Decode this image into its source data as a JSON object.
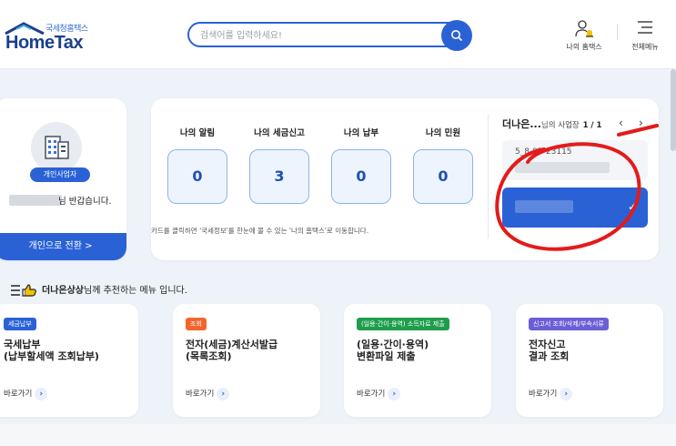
{
  "header": {
    "logo_sub": "국세청홈택스",
    "logo_main": "HomeTax",
    "search_placeholder": "검색어를 입력하세요!",
    "my_hometax_label": "나의 홈택스",
    "all_menu_label": "전체메뉴"
  },
  "profile": {
    "badge": "개인사업자",
    "greeting": "님 반갑습니다.",
    "switch_label": "개인으로 전환 >"
  },
  "status": {
    "items": [
      {
        "label": "나의 알림",
        "value": "0"
      },
      {
        "label": "나의 세금신고",
        "value": "3"
      },
      {
        "label": "나의 납부",
        "value": "0"
      },
      {
        "label": "나의 민원",
        "value": "0"
      }
    ],
    "hint": "카드를 클릭하면 '국세정보'를 한눈에 볼 수 있는 '나의 홈택스'로 이동합니다.",
    "business": {
      "name": "더나은...",
      "suffix": "님의 사업장",
      "count": "1 / 1",
      "number": "5_8-97-23115"
    }
  },
  "recommend": {
    "name": "더나은상상",
    "suffix": "님께 추천하는 메뉴 입니다.",
    "go_label": "바로가기",
    "cards": [
      {
        "tag": "세금납부",
        "tag_color": "#2a62d6",
        "title": "국세납부\n(납부할세액 조회납부)"
      },
      {
        "tag": "조회",
        "tag_color": "#f2662d",
        "title": "전자(세금)계산서발급\n(목록조회)"
      },
      {
        "tag": "(일용·간이·용역) 소득자료 제출",
        "tag_color": "#1e9e4a",
        "title": "(일용·간이·용역)\n변환파일 제출"
      },
      {
        "tag": "신고서 조회/삭제/부속서류",
        "tag_color": "#6a5fd6",
        "title": "전자신고\n결과 조회"
      }
    ]
  }
}
